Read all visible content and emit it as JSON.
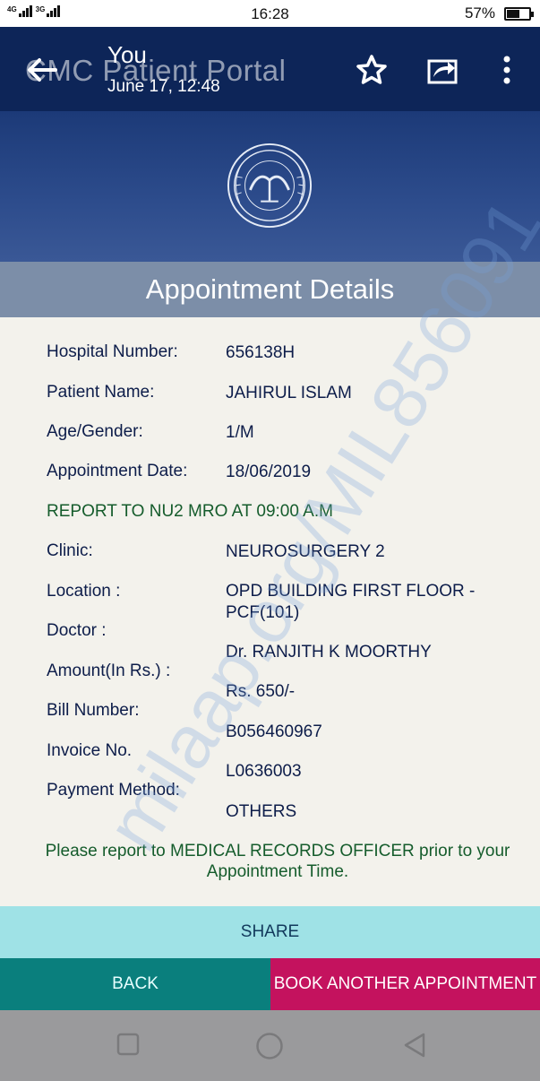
{
  "status_bar": {
    "network_1": "4G",
    "network_2": "3G",
    "time": "16:28",
    "battery": "57%",
    "battery_level": 0.57
  },
  "app_bar": {
    "title": "CMC Patient Portal",
    "sender": "You",
    "timestamp": "June 17, 12:48"
  },
  "heading": "Appointment Details",
  "fields": [
    {
      "label": "Hospital Number:",
      "value": "656138H"
    },
    {
      "label": "Patient Name:",
      "value": "JAHIRUL ISLAM"
    },
    {
      "label": "Age/Gender:",
      "value": "1/M"
    },
    {
      "label": "Appointment Date:",
      "value": "18/06/2019"
    },
    {
      "label": "Clinic:",
      "value": "NEUROSURGERY 2"
    },
    {
      "label": "Location :",
      "value": "OPD BUILDING FIRST FLOOR - PCF(101)"
    },
    {
      "label": "Doctor :",
      "value": "Dr. RANJITH K MOORTHY"
    },
    {
      "label": "Amount(In Rs.) :",
      "value": "Rs. 650/-"
    },
    {
      "label": "Bill Number:",
      "value": "B056460967"
    },
    {
      "label": "Invoice No.",
      "value": "L0636003"
    },
    {
      "label": "Payment Method:",
      "value": "OTHERS"
    }
  ],
  "report_line": "REPORT TO NU2 MRO AT 09:00 A.M",
  "note": "Please report to MEDICAL RECORDS OFFICER prior to your Appointment Time.",
  "watermark": "milaap.org/MIL856091",
  "buttons": {
    "share": "SHARE",
    "back": "BACK",
    "book": "BOOK ANOTHER APPOINTMENT"
  },
  "colors": {
    "app_bar": "#0d2558",
    "share": "#9fe2e6",
    "back": "#0a7f7d",
    "book": "#c4125e",
    "text": "#0d1d4a",
    "green": "#155c2c"
  }
}
